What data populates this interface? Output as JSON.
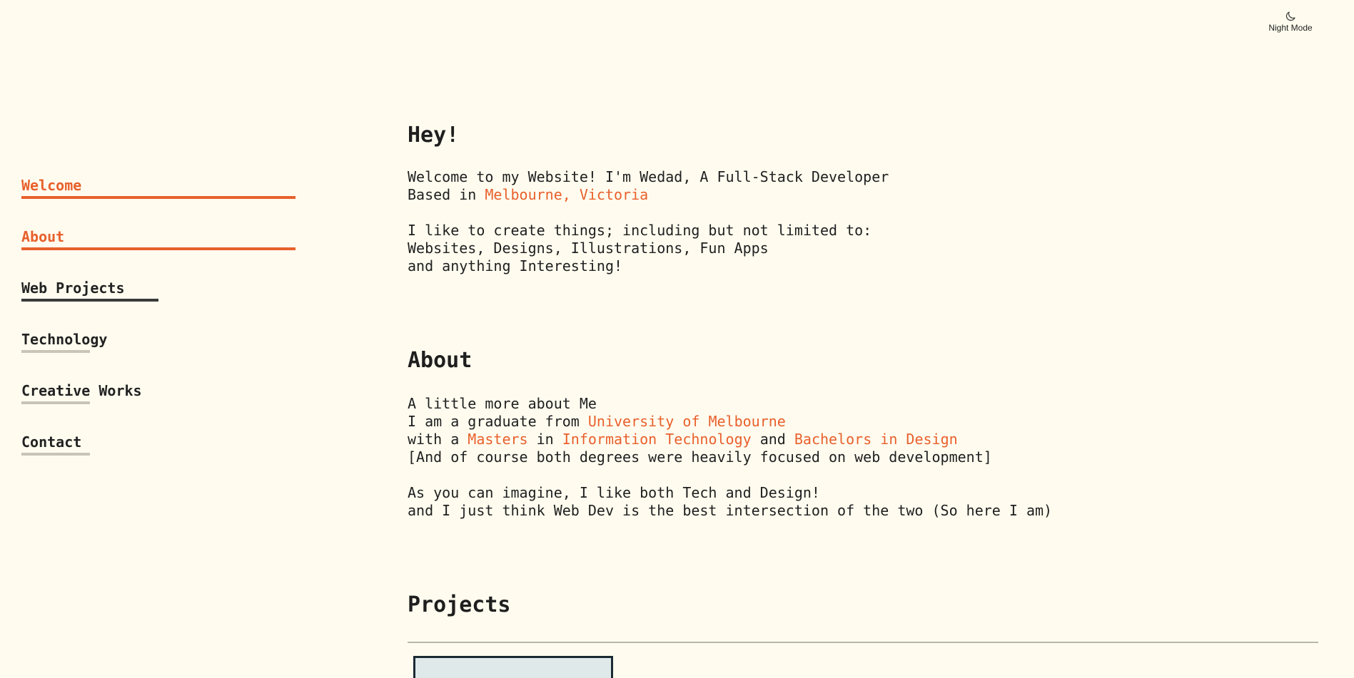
{
  "night_mode": {
    "label": "Night Mode",
    "icon": "moon-icon"
  },
  "nav": {
    "items": [
      {
        "label": "Welcome",
        "state": "active"
      },
      {
        "label": "About",
        "state": "active"
      },
      {
        "label": "Web Projects",
        "state": "partial"
      },
      {
        "label": "Technology",
        "state": "inactive"
      },
      {
        "label": "Creative Works",
        "state": "inactive"
      },
      {
        "label": "Contact",
        "state": "inactive"
      }
    ]
  },
  "hey": {
    "title": "Hey!",
    "line1": "Welcome to my Website! I'm Wedad, A Full-Stack Developer",
    "line2_prefix": "Based in ",
    "location": "Melbourne, Victoria",
    "line3": "I like to create things; including but not limited to:",
    "line4": "Websites, Designs, Illustrations, Fun Apps",
    "line5": "and anything Interesting!"
  },
  "about": {
    "title": "About",
    "line1": "A little more about Me",
    "line2_prefix": "I am a graduate from ",
    "university": "University of Melbourne",
    "line3_prefix": "with a ",
    "degree1": "Masters",
    "line3_mid1": " in ",
    "field1": "Information Technology",
    "line3_mid2": " and ",
    "degree2": "Bachelors in Design",
    "line4": "[And of course both degrees were heavily focused on web development]",
    "line5": "As you can imagine, I like both Tech and Design!",
    "line6": "and I just think Web Dev is the best intersection of the two (So here I am)"
  },
  "projects": {
    "title": "Projects"
  },
  "colors": {
    "accent": "#e8602c",
    "background": "#fffcef",
    "text": "#1f1f1f"
  }
}
